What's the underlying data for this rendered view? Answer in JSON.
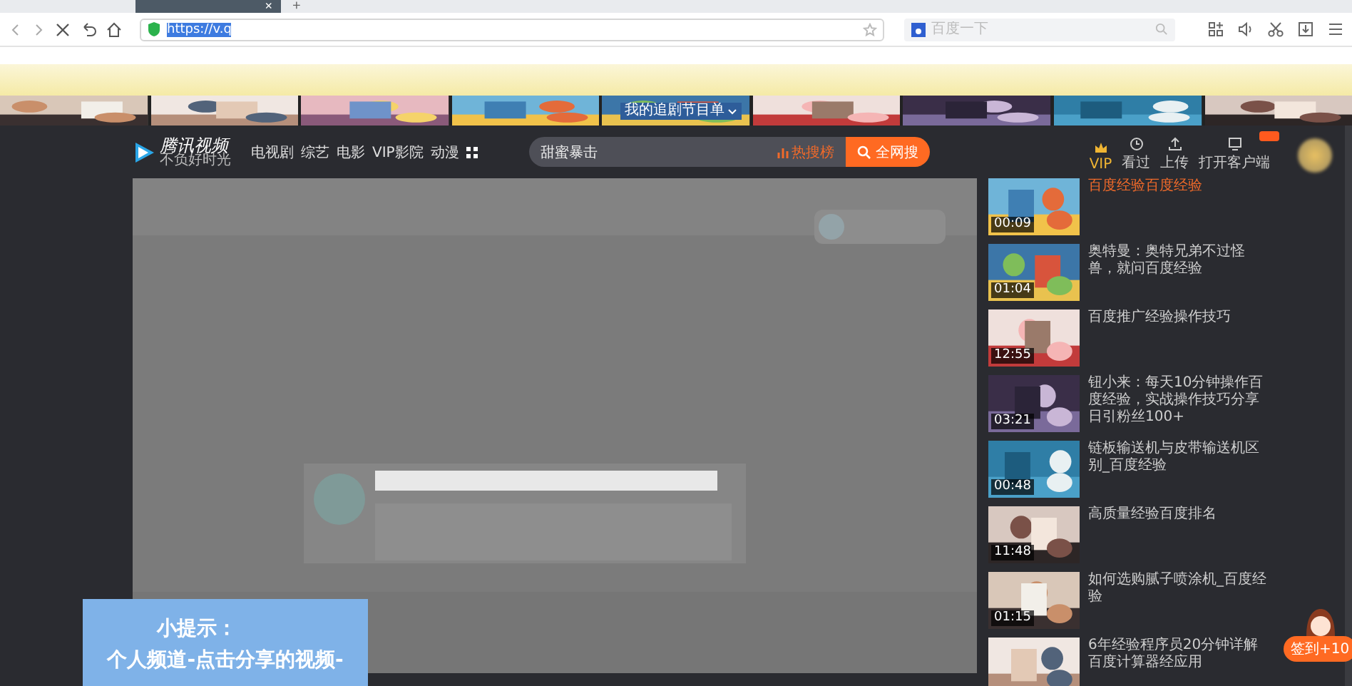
{
  "browser": {
    "tab_close": "×",
    "new_tab": "+",
    "address": {
      "value": "https://v.q",
      "selected": true
    },
    "search": {
      "placeholder": "百度一下"
    }
  },
  "banner": {
    "menu_label": "我的追剧节目单"
  },
  "site": {
    "logo": {
      "name": "腾讯视频",
      "slogan": "不负好时光"
    },
    "nav": [
      "电视剧",
      "综艺",
      "电影",
      "VIP影院",
      "动漫"
    ],
    "search": {
      "value": "甜蜜暴击",
      "hot": "热搜榜",
      "button": "全网搜"
    },
    "actions": [
      {
        "label": "VIP",
        "kind": "vip"
      },
      {
        "label": "看过",
        "kind": "history"
      },
      {
        "label": "上传",
        "kind": "upload"
      },
      {
        "label": "打开客户端",
        "kind": "client"
      }
    ]
  },
  "playlist": [
    {
      "title": "百度经验百度经验",
      "duration": "00:09",
      "selected": true
    },
    {
      "title": "奥特曼：奥特兄弟不过怪兽，就问百度经验",
      "duration": "01:04",
      "selected": false
    },
    {
      "title": "百度推广经验操作技巧",
      "duration": "12:55",
      "selected": false
    },
    {
      "title": "钮小来：每天10分钟操作百度经验，实战操作技巧分享日引粉丝100+",
      "duration": "03:21",
      "selected": false
    },
    {
      "title": "链板输送机与皮带输送机区别_百度经验",
      "duration": "00:48",
      "selected": false
    },
    {
      "title": "高质量经验百度排名",
      "duration": "11:48",
      "selected": false
    },
    {
      "title": "如何选购腻子喷涂机_百度经验",
      "duration": "01:15",
      "selected": false
    },
    {
      "title": "6年经验程序员20分钟详解百度计算器经应用",
      "selected": false
    }
  ],
  "tip": {
    "title": "小提示：",
    "text": "个人频道-点击分享的视频-"
  },
  "sign_in": "签到+10"
}
